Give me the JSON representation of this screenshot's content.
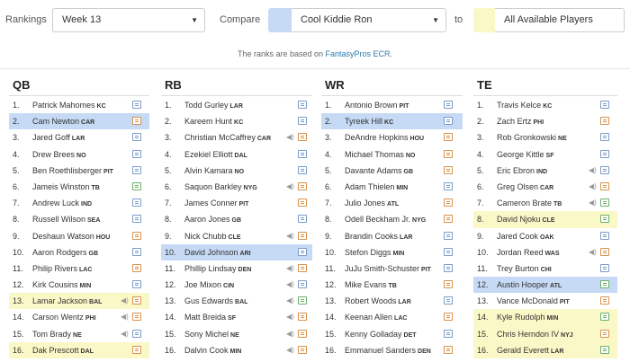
{
  "toolbar": {
    "rankings_label": "Rankings",
    "week_value": "Week 13",
    "compare_label": "Compare",
    "compare_value": "Cool Kiddie Ron",
    "to_label": "to",
    "to_value": "All Available Players",
    "compare_swatch_color": "#c6daf5",
    "to_swatch_color": "#fbf8c8"
  },
  "note": {
    "prefix": "The ranks are based on ",
    "link": "FantasyPros ECR",
    "suffix": "."
  },
  "columns": [
    {
      "title": "QB",
      "rows": [
        {
          "rank": "1.",
          "name": "Patrick Mahomes",
          "team": "KC",
          "icon": "note",
          "audio": false,
          "hl": ""
        },
        {
          "rank": "2.",
          "name": "Cam Newton",
          "team": "CAR",
          "icon": "note-orange",
          "audio": false,
          "hl": "blue"
        },
        {
          "rank": "3.",
          "name": "Jared Goff",
          "team": "LAR",
          "icon": "note",
          "audio": false,
          "hl": ""
        },
        {
          "rank": "4.",
          "name": "Drew Brees",
          "team": "NO",
          "icon": "note",
          "audio": false,
          "hl": ""
        },
        {
          "rank": "5.",
          "name": "Ben Roethlisberger",
          "team": "PIT",
          "icon": "note",
          "audio": false,
          "hl": ""
        },
        {
          "rank": "6.",
          "name": "Jameis Winston",
          "team": "TB",
          "icon": "note-green",
          "audio": false,
          "hl": ""
        },
        {
          "rank": "7.",
          "name": "Andrew Luck",
          "team": "IND",
          "icon": "note",
          "audio": false,
          "hl": ""
        },
        {
          "rank": "8.",
          "name": "Russell Wilson",
          "team": "SEA",
          "icon": "note",
          "audio": false,
          "hl": ""
        },
        {
          "rank": "9.",
          "name": "Deshaun Watson",
          "team": "HOU",
          "icon": "note-orange",
          "audio": false,
          "hl": ""
        },
        {
          "rank": "10.",
          "name": "Aaron Rodgers",
          "team": "GB",
          "icon": "note",
          "audio": false,
          "hl": ""
        },
        {
          "rank": "11.",
          "name": "Philip Rivers",
          "team": "LAC",
          "icon": "note-orange",
          "audio": false,
          "hl": ""
        },
        {
          "rank": "12.",
          "name": "Kirk Cousins",
          "team": "MIN",
          "icon": "note",
          "audio": false,
          "hl": ""
        },
        {
          "rank": "13.",
          "name": "Lamar Jackson",
          "team": "BAL",
          "icon": "note-orange",
          "audio": true,
          "hl": "yellow"
        },
        {
          "rank": "14.",
          "name": "Carson Wentz",
          "team": "PHI",
          "icon": "note-orange",
          "audio": true,
          "hl": ""
        },
        {
          "rank": "15.",
          "name": "Tom Brady",
          "team": "NE",
          "icon": "note",
          "audio": true,
          "hl": ""
        },
        {
          "rank": "16.",
          "name": "Dak Prescott",
          "team": "DAL",
          "icon": "note-orange",
          "audio": false,
          "hl": "yellow"
        }
      ]
    },
    {
      "title": "RB",
      "rows": [
        {
          "rank": "1.",
          "name": "Todd Gurley",
          "team": "LAR",
          "icon": "note",
          "audio": false,
          "hl": ""
        },
        {
          "rank": "2.",
          "name": "Kareem Hunt",
          "team": "KC",
          "icon": "note",
          "audio": false,
          "hl": ""
        },
        {
          "rank": "3.",
          "name": "Christian McCaffrey",
          "team": "CAR",
          "icon": "note-orange",
          "audio": true,
          "hl": ""
        },
        {
          "rank": "4.",
          "name": "Ezekiel Elliott",
          "team": "DAL",
          "icon": "note",
          "audio": false,
          "hl": ""
        },
        {
          "rank": "5.",
          "name": "Alvin Kamara",
          "team": "NO",
          "icon": "note",
          "audio": false,
          "hl": ""
        },
        {
          "rank": "6.",
          "name": "Saquon Barkley",
          "team": "NYG",
          "icon": "note-orange",
          "audio": true,
          "hl": ""
        },
        {
          "rank": "7.",
          "name": "James Conner",
          "team": "PIT",
          "icon": "note-orange",
          "audio": false,
          "hl": ""
        },
        {
          "rank": "8.",
          "name": "Aaron Jones",
          "team": "GB",
          "icon": "note",
          "audio": false,
          "hl": ""
        },
        {
          "rank": "9.",
          "name": "Nick Chubb",
          "team": "CLE",
          "icon": "note-orange",
          "audio": true,
          "hl": ""
        },
        {
          "rank": "10.",
          "name": "David Johnson",
          "team": "ARI",
          "icon": "note",
          "audio": false,
          "hl": "blue"
        },
        {
          "rank": "11.",
          "name": "Phillip Lindsay",
          "team": "DEN",
          "icon": "note-orange",
          "audio": true,
          "hl": ""
        },
        {
          "rank": "12.",
          "name": "Joe Mixon",
          "team": "CIN",
          "icon": "note",
          "audio": true,
          "hl": ""
        },
        {
          "rank": "13.",
          "name": "Gus Edwards",
          "team": "BAL",
          "icon": "note-green",
          "audio": true,
          "hl": ""
        },
        {
          "rank": "14.",
          "name": "Matt Breida",
          "team": "SF",
          "icon": "note-orange",
          "audio": true,
          "hl": ""
        },
        {
          "rank": "15.",
          "name": "Sony Michel",
          "team": "NE",
          "icon": "note-orange",
          "audio": true,
          "hl": ""
        },
        {
          "rank": "16.",
          "name": "Dalvin Cook",
          "team": "MIN",
          "icon": "note-orange",
          "audio": true,
          "hl": ""
        }
      ]
    },
    {
      "title": "WR",
      "rows": [
        {
          "rank": "1.",
          "name": "Antonio Brown",
          "team": "PIT",
          "icon": "note",
          "audio": false,
          "hl": ""
        },
        {
          "rank": "2.",
          "name": "Tyreek Hill",
          "team": "KC",
          "icon": "note",
          "audio": false,
          "hl": "blue"
        },
        {
          "rank": "3.",
          "name": "DeAndre Hopkins",
          "team": "HOU",
          "icon": "note-orange",
          "audio": false,
          "hl": ""
        },
        {
          "rank": "4.",
          "name": "Michael Thomas",
          "team": "NO",
          "icon": "note-orange",
          "audio": false,
          "hl": ""
        },
        {
          "rank": "5.",
          "name": "Davante Adams",
          "team": "GB",
          "icon": "note-orange",
          "audio": false,
          "hl": ""
        },
        {
          "rank": "6.",
          "name": "Adam Thielen",
          "team": "MIN",
          "icon": "note",
          "audio": false,
          "hl": ""
        },
        {
          "rank": "7.",
          "name": "Julio Jones",
          "team": "ATL",
          "icon": "note-orange",
          "audio": false,
          "hl": ""
        },
        {
          "rank": "8.",
          "name": "Odell Beckham Jr.",
          "team": "NYG",
          "icon": "note-orange",
          "audio": false,
          "hl": ""
        },
        {
          "rank": "9.",
          "name": "Brandin Cooks",
          "team": "LAR",
          "icon": "note",
          "audio": false,
          "hl": ""
        },
        {
          "rank": "10.",
          "name": "Stefon Diggs",
          "team": "MIN",
          "icon": "note",
          "audio": false,
          "hl": ""
        },
        {
          "rank": "11.",
          "name": "JuJu Smith-Schuster",
          "team": "PIT",
          "icon": "note",
          "audio": false,
          "hl": ""
        },
        {
          "rank": "12.",
          "name": "Mike Evans",
          "team": "TB",
          "icon": "note-orange",
          "audio": false,
          "hl": ""
        },
        {
          "rank": "13.",
          "name": "Robert Woods",
          "team": "LAR",
          "icon": "note",
          "audio": false,
          "hl": ""
        },
        {
          "rank": "14.",
          "name": "Keenan Allen",
          "team": "LAC",
          "icon": "note-orange",
          "audio": false,
          "hl": ""
        },
        {
          "rank": "15.",
          "name": "Kenny Golladay",
          "team": "DET",
          "icon": "note",
          "audio": false,
          "hl": ""
        },
        {
          "rank": "16.",
          "name": "Emmanuel Sanders",
          "team": "DEN",
          "icon": "note-orange",
          "audio": false,
          "hl": ""
        }
      ]
    },
    {
      "title": "TE",
      "rows": [
        {
          "rank": "1.",
          "name": "Travis Kelce",
          "team": "KC",
          "icon": "note",
          "audio": false,
          "hl": ""
        },
        {
          "rank": "2.",
          "name": "Zach Ertz",
          "team": "PHI",
          "icon": "note-orange",
          "audio": false,
          "hl": ""
        },
        {
          "rank": "3.",
          "name": "Rob Gronkowski",
          "team": "NE",
          "icon": "note",
          "audio": false,
          "hl": ""
        },
        {
          "rank": "4.",
          "name": "George Kittle",
          "team": "SF",
          "icon": "note",
          "audio": false,
          "hl": ""
        },
        {
          "rank": "5.",
          "name": "Eric Ebron",
          "team": "IND",
          "icon": "note",
          "audio": true,
          "hl": ""
        },
        {
          "rank": "6.",
          "name": "Greg Olsen",
          "team": "CAR",
          "icon": "note-orange",
          "audio": true,
          "hl": ""
        },
        {
          "rank": "7.",
          "name": "Cameron Brate",
          "team": "TB",
          "icon": "note-green",
          "audio": true,
          "hl": ""
        },
        {
          "rank": "8.",
          "name": "David Njoku",
          "team": "CLE",
          "icon": "note-green",
          "audio": false,
          "hl": "yellow"
        },
        {
          "rank": "9.",
          "name": "Jared Cook",
          "team": "OAK",
          "icon": "note",
          "audio": false,
          "hl": ""
        },
        {
          "rank": "10.",
          "name": "Jordan Reed",
          "team": "WAS",
          "icon": "note-orange",
          "audio": true,
          "hl": ""
        },
        {
          "rank": "11.",
          "name": "Trey Burton",
          "team": "CHI",
          "icon": "note",
          "audio": false,
          "hl": ""
        },
        {
          "rank": "12.",
          "name": "Austin Hooper",
          "team": "ATL",
          "icon": "note-green",
          "audio": false,
          "hl": "blue"
        },
        {
          "rank": "13.",
          "name": "Vance McDonald",
          "team": "PIT",
          "icon": "note-orange",
          "audio": false,
          "hl": ""
        },
        {
          "rank": "14.",
          "name": "Kyle Rudolph",
          "team": "MIN",
          "icon": "note-green",
          "audio": false,
          "hl": "yellow"
        },
        {
          "rank": "15.",
          "name": "Chris Herndon IV",
          "team": "NYJ",
          "icon": "note-orange",
          "audio": false,
          "hl": "yellow"
        },
        {
          "rank": "16.",
          "name": "Gerald Everett",
          "team": "LAR",
          "icon": "note-green",
          "audio": false,
          "hl": "yellow"
        }
      ]
    }
  ]
}
